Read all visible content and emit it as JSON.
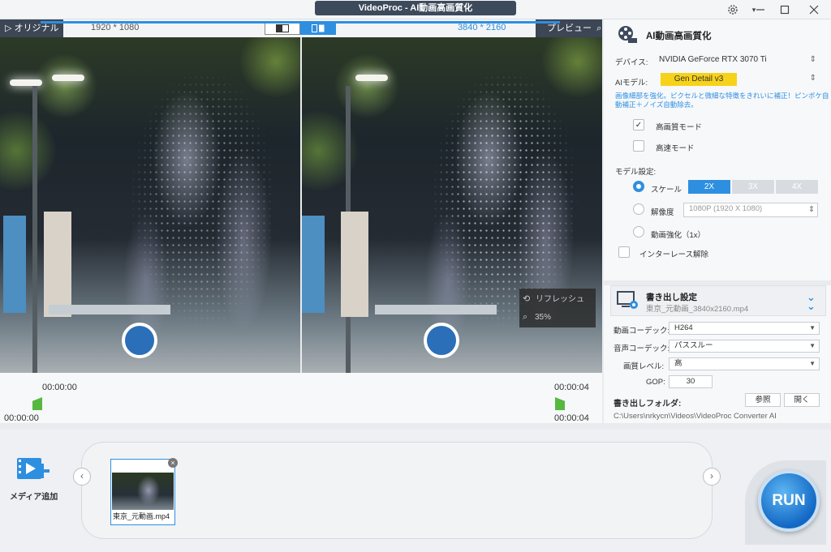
{
  "window": {
    "title": "VideoProc -  AI動画高画質化"
  },
  "preview": {
    "original_label": "▷ オリジナル",
    "original_res": "1920 * 1080",
    "preview_label": "プレビュー",
    "preview_res": "3840 * 2160",
    "refresh_label": "リフレッシュ",
    "zoom_label": "35%"
  },
  "timeline": {
    "start_top": "00:00:00",
    "start_bottom": "00:00:00",
    "end_top": "00:00:04",
    "end_bottom": "00:00:04"
  },
  "ai_panel": {
    "heading": "AI動画高画質化",
    "device_label": "デバイス:",
    "device_value": "NVIDIA GeForce RTX 3070 Ti",
    "model_label": "AIモデル:",
    "model_value": "Gen Detail v3",
    "model_desc": "画像細部を強化。ピクセルと微細な特徴をきれいに補正！ピンボケ自動補正＋ノイズ自動除去。",
    "hq_mode_label": "高画質モード",
    "fast_mode_label": "高速モード",
    "model_settings_label": "モデル設定:",
    "scale_label": "スケール",
    "scale_options": [
      "2X",
      "3X",
      "4X"
    ],
    "resolution_label": "解像度",
    "resolution_value": "1080P (1920 X 1080)",
    "enhance_label": "動画強化（1x）",
    "deinterlace_label": "インターレース解除"
  },
  "export": {
    "heading": "書き出し設定",
    "filename": "東京_元動画_3840x2160.mp4",
    "video_codec_label": "動画コーデック:",
    "video_codec_value": "H264",
    "audio_codec_label": "音声コーデック:",
    "audio_codec_value": "パススルー",
    "quality_label": "画質レベル:",
    "quality_value": "高",
    "gop_label": "GOP:",
    "gop_value": "30",
    "folder_label": "書き出しフォルダ:",
    "browse_label": "参照",
    "open_label": "開く",
    "folder_path": "C:\\Users\\nrkycn\\Videos\\VideoProc Converter AI"
  },
  "bottom": {
    "add_media_label": "メディア追加",
    "thumb_filename": "東京_元動画.mp4",
    "run_label": "RUN"
  },
  "colors": {
    "accent": "#2e8fe0",
    "title_pill": "#3d4a5c",
    "model_badge": "#f7d21a",
    "flag": "#57b840"
  }
}
